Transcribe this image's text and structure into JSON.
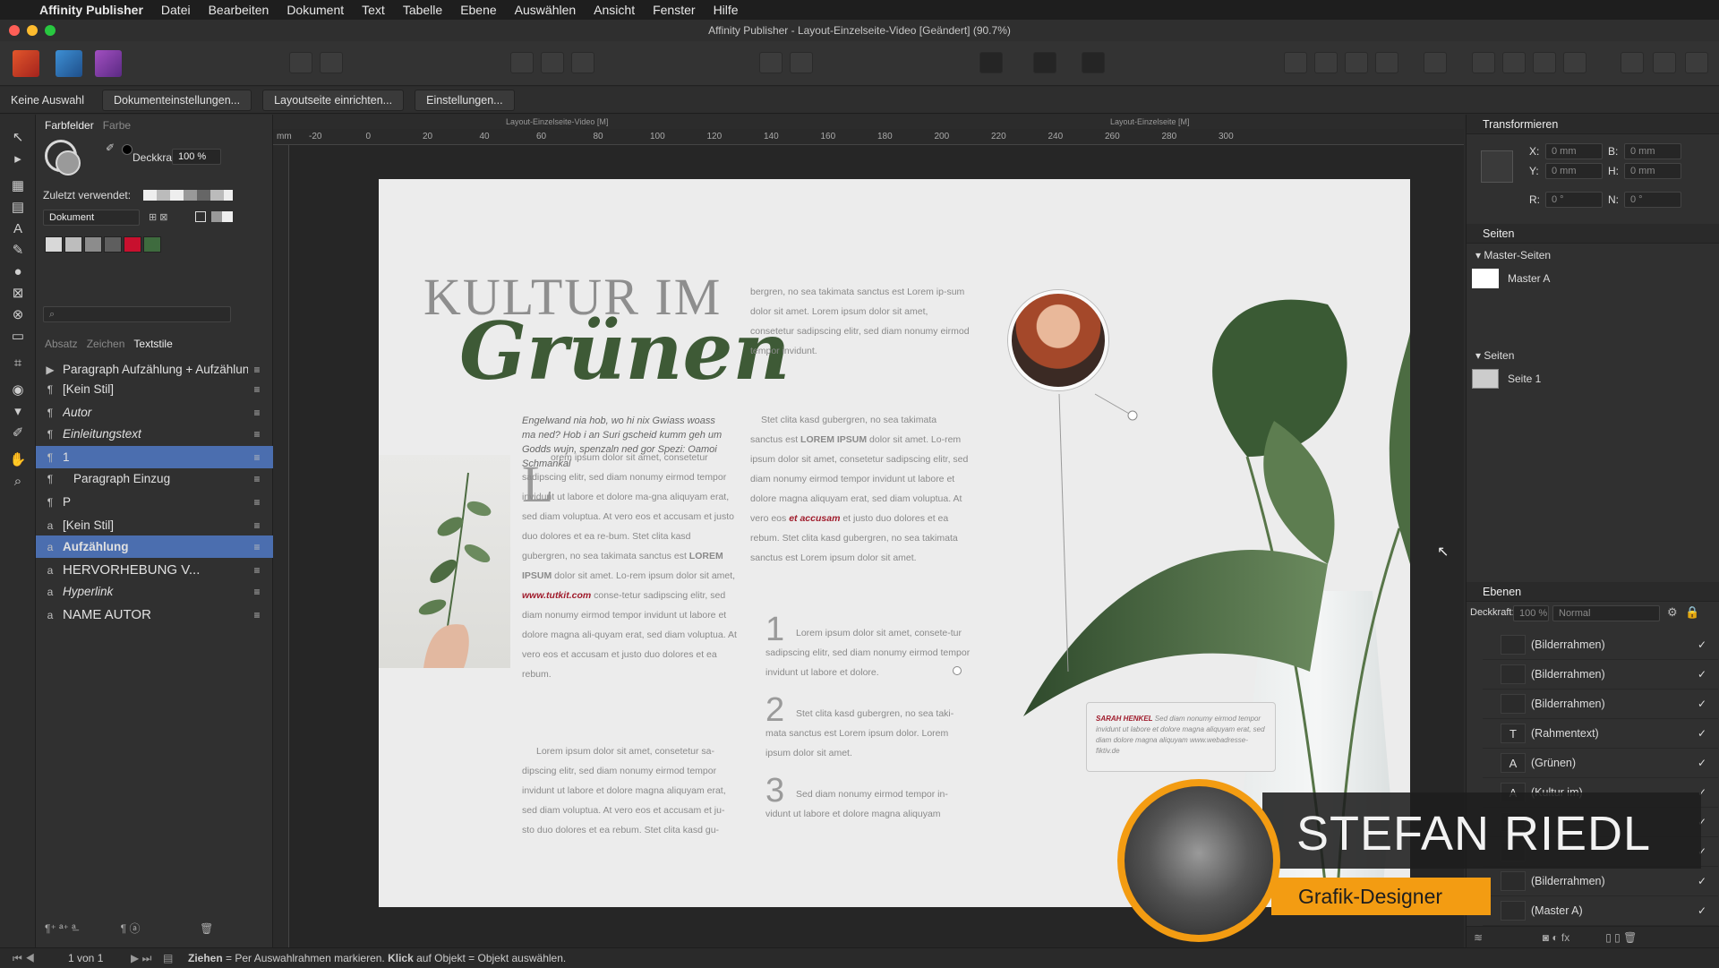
{
  "menubar": {
    "app_name": "Affinity Publisher",
    "items": [
      "Datei",
      "Bearbeiten",
      "Dokument",
      "Text",
      "Tabelle",
      "Ebene",
      "Auswählen",
      "Ansicht",
      "Fenster",
      "Hilfe"
    ]
  },
  "window": {
    "title": "Affinity Publisher - Layout-Einzelseite-Video [Geändert] (90.7%)"
  },
  "context_bar": {
    "selection": "Keine Auswahl",
    "buttons": [
      "Dokumenteinstellungen...",
      "Layoutseite einrichten...",
      "Einstellungen..."
    ]
  },
  "left_panel": {
    "swatch_tabs": {
      "active": "Farbfelder",
      "other": "Farbe"
    },
    "opacity_label": "Deckkraft:",
    "opacity_value": "100 %",
    "recent_label": "Zuletzt verwendet:",
    "palette_select": "Dokument",
    "swatch_colors": [
      "#d8d8d8",
      "#bdbdbd",
      "#8c8c8c",
      "#5e5e5e",
      "#c8102e",
      "#3e6b3e"
    ],
    "style_tabs": {
      "t1": "Absatz",
      "t2": "Zeichen",
      "t3": "Textstile"
    },
    "styles": [
      {
        "icon": "▶",
        "label": "Paragraph Aufzählung + Aufzählung"
      },
      {
        "icon": "¶",
        "label": "[Kein Stil]"
      },
      {
        "icon": "¶",
        "label": "Autor"
      },
      {
        "icon": "¶",
        "label": "Einleitungstext"
      },
      {
        "icon": "¶",
        "label": "1"
      },
      {
        "icon": "¶",
        "label": "Paragraph Einzug"
      },
      {
        "icon": "¶",
        "label": "P"
      },
      {
        "icon": "a",
        "label": "[Kein Stil]"
      },
      {
        "icon": "a",
        "label": "Aufzählung"
      },
      {
        "icon": "a",
        "label": "HERVORHEBUNG V..."
      },
      {
        "icon": "a",
        "label": "Hyperlink"
      },
      {
        "icon": "a",
        "label": "NAME AUTOR"
      }
    ]
  },
  "canvas": {
    "tab_left": "Layout-Einzelseite-Video [M]",
    "tab_right": "Layout-Einzelseite [M]",
    "ruler_unit": "mm",
    "ruler_labels": [
      "-20",
      "0",
      "20",
      "40",
      "60",
      "80",
      "100",
      "120",
      "140",
      "160",
      "180",
      "200",
      "220",
      "240",
      "260",
      "280",
      "300"
    ],
    "page": {
      "title_top": "KULTUR IM",
      "title_script": "Grünen",
      "intro": "Engelwand nia hob, wo hi nix Gwiass woass ma ned? Hob i an Suri gscheid kumm geh um Godds wujn, spenzaln ned gor Spezi: Oamoi Schmankal",
      "col2_a": "bergren, no sea takimata sanctus est Lorem ip-sum dolor sit amet. Lorem ipsum dolor sit amet, consetetur sadipscing elitr, sed diam nonumy eirmod tempor invidunt.",
      "col2_b1": "Stet clita kasd gubergren, no sea takimata sanctus est ",
      "col2_b2": "LOREM IPSUM",
      "col2_b3": " dolor sit amet. Lo-rem ipsum dolor sit amet, consetetur sadipscing elitr, sed diam nonumy eirmod tempor invidunt ut labore et dolore magna aliquyam erat, sed diam voluptua. At vero eos ",
      "col2_b4": "et accusam",
      "col2_b5": " et justo duo dolores et ea rebum. Stet clita kasd gubergren, no sea takimata sanctus est Lorem ipsum dolor sit amet.",
      "col1_dropcap": "L",
      "col1_a": "orem ipsum dolor sit amet, consetetur sadipscing elitr, sed diam nonumy eirmod tempor invidunt ut labore et dolore ma-gna aliquyam erat, sed diam voluptua. At vero eos et accusam et justo duo dolores et ea re-bum. Stet clita kasd gubergren, no sea takimata sanctus est ",
      "col1_b": "LOREM IPSUM",
      "col1_c": " dolor sit amet. Lo-rem ipsum dolor sit amet, ",
      "col1_link": "www.tutkit.com",
      "col1_d": " conse-tetur sadipscing elitr, sed diam nonumy eirmod tempor invidunt ut labore et dolore magna ali-quyam erat, sed diam voluptua. At vero eos et accusam et justo duo dolores et ea rebum.",
      "col1_e": "Lorem ipsum dolor sit amet, consetetur sa-dipscing elitr, sed diam nonumy eirmod tempor invidunt ut labore et dolore magna aliquyam erat, sed diam voluptua. At vero eos et accusam et ju-sto duo dolores et ea rebum. Stet clita kasd gu-",
      "list": [
        {
          "num": "1",
          "text": "Lorem ipsum dolor sit amet, consete-tur sadipscing elitr, sed diam nonumy eirmod tempor invidunt ut labore et dolore."
        },
        {
          "num": "2",
          "text": "Stet clita kasd gubergren, no sea taki-mata sanctus est Lorem ipsum dolor. Lorem ipsum dolor sit amet."
        },
        {
          "num": "3",
          "text": "Sed diam nonumy eirmod tempor in-vidunt ut labore et dolore magna aliquyam"
        }
      ],
      "caption_name": "SARAH HENKEL",
      "caption_text": " Sed diam nonumy eirmod tempor invidunt ut labore et dolore magna aliquyam erat, sed diam dolore magna aliquyam www.webadresse-fiktiv.de"
    }
  },
  "right_panel": {
    "transform": {
      "title": "Transformieren",
      "x_label": "X:",
      "x_value": "0 mm",
      "y_label": "Y:",
      "y_value": "0 mm",
      "b_label": "B:",
      "b_value": "0 mm",
      "h_label": "H:",
      "h_value": "0 mm",
      "r_label": "R:",
      "r_value": "0 °",
      "n_label": "N:",
      "n_value": "0 °"
    },
    "pages": {
      "title": "Seiten",
      "master_section": "Master-Seiten",
      "master_item": "Master A",
      "pages_section": "Seiten",
      "page_item": "Seite 1"
    },
    "layers": {
      "title": "Ebenen",
      "opacity_label": "Deckkraft:",
      "opacity_value": "100 %",
      "blend_mode": "Normal",
      "items": [
        {
          "icon": "",
          "name": "(Bilderrahmen)"
        },
        {
          "icon": "",
          "name": "(Bilderrahmen)"
        },
        {
          "icon": "",
          "name": "(Bilderrahmen)"
        },
        {
          "icon": "T",
          "name": "(Rahmentext)"
        },
        {
          "icon": "A",
          "name": "(Grünen)"
        },
        {
          "icon": "A",
          "name": "(Kultur im)"
        },
        {
          "icon": "",
          "name": ""
        },
        {
          "icon": "",
          "name": ""
        },
        {
          "icon": "",
          "name": "(Bilderrahmen)"
        },
        {
          "icon": "",
          "name": "(Master A)"
        }
      ]
    }
  },
  "status": {
    "page_indicator": "1 von 1",
    "hint_b1": "Ziehen",
    "hint_t1": " = Per Auswahlrahmen markieren. ",
    "hint_b2": "Klick",
    "hint_t2": " auf Objekt = Objekt auswählen."
  },
  "overlay": {
    "name": "STEFAN RIEDL",
    "role": "Grafik-Designer"
  },
  "colors": {
    "accent_orange": "#f39c12",
    "selection_blue": "#4b6eaf",
    "title_green": "#3e5a36",
    "link_red": "#a01c2c"
  }
}
